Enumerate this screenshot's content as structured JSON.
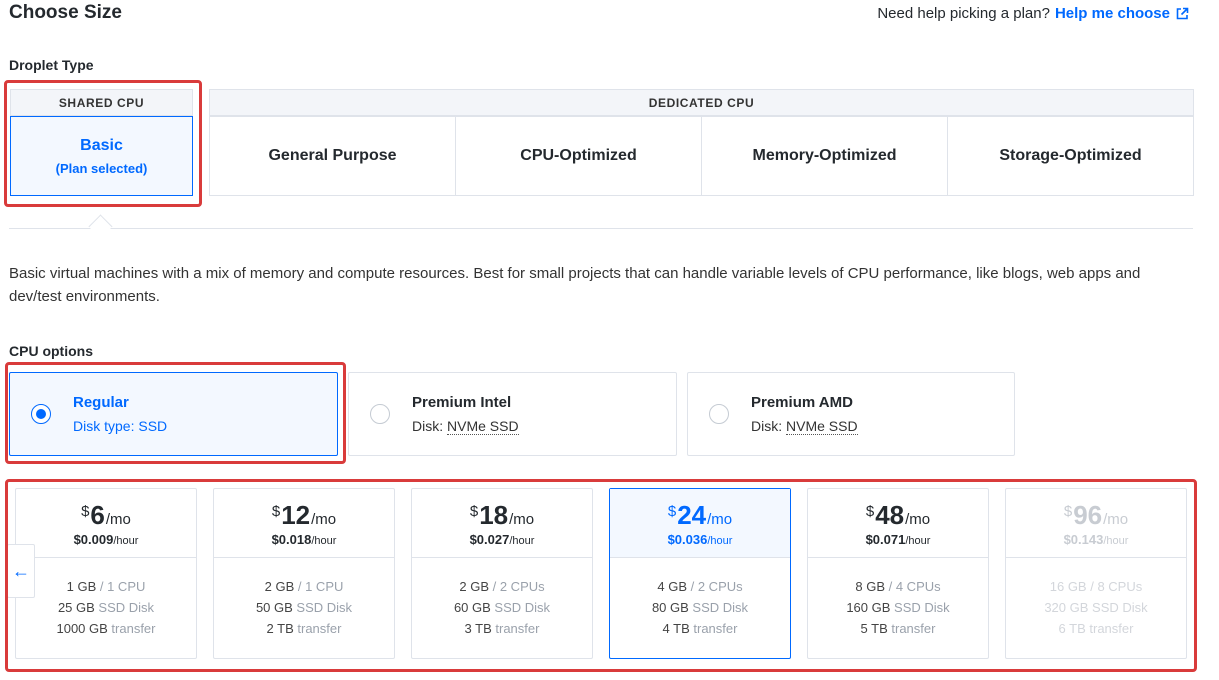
{
  "header": {
    "title": "Choose Size",
    "help_text": "Need help picking a plan?",
    "help_link": "Help me choose"
  },
  "droplet_type": {
    "label": "Droplet Type",
    "shared_header": "SHARED CPU",
    "dedicated_header": "DEDICATED CPU",
    "basic": {
      "label": "Basic",
      "sub": "(Plan selected)"
    },
    "dedicated": [
      "General Purpose",
      "CPU-Optimized",
      "Memory-Optimized",
      "Storage-Optimized"
    ]
  },
  "description": "Basic virtual machines with a mix of memory and compute resources. Best for small projects that can handle variable levels of CPU performance, like blogs, web apps and dev/test environments.",
  "cpu_options": {
    "label": "CPU options",
    "options": [
      {
        "name": "Regular",
        "disk_prefix": "Disk type: ",
        "disk_value": "SSD",
        "selected": true
      },
      {
        "name": "Premium Intel",
        "disk_prefix": "Disk: ",
        "disk_value": "NVMe SSD",
        "selected": false
      },
      {
        "name": "Premium AMD",
        "disk_prefix": "Disk: ",
        "disk_value": "NVMe SSD",
        "selected": false
      }
    ]
  },
  "plans": [
    {
      "currency": "$",
      "amount": "6",
      "per": "/mo",
      "hourly": "$0.009",
      "hourly_unit": "/hour",
      "mem": "1 GB",
      "cpu": " / 1 CPU",
      "disk": "25 GB",
      "disk_type": " SSD Disk",
      "transfer": "1000 GB",
      "transfer_label": " transfer",
      "state": "normal"
    },
    {
      "currency": "$",
      "amount": "12",
      "per": "/mo",
      "hourly": "$0.018",
      "hourly_unit": "/hour",
      "mem": "2 GB",
      "cpu": " / 1 CPU",
      "disk": "50 GB",
      "disk_type": " SSD Disk",
      "transfer": "2 TB",
      "transfer_label": " transfer",
      "state": "normal"
    },
    {
      "currency": "$",
      "amount": "18",
      "per": "/mo",
      "hourly": "$0.027",
      "hourly_unit": "/hour",
      "mem": "2 GB",
      "cpu": " / 2 CPUs",
      "disk": "60 GB",
      "disk_type": " SSD Disk",
      "transfer": "3 TB",
      "transfer_label": " transfer",
      "state": "normal"
    },
    {
      "currency": "$",
      "amount": "24",
      "per": "/mo",
      "hourly": "$0.036",
      "hourly_unit": "/hour",
      "mem": "4 GB",
      "cpu": " / 2 CPUs",
      "disk": "80 GB",
      "disk_type": " SSD Disk",
      "transfer": "4 TB",
      "transfer_label": " transfer",
      "state": "selected"
    },
    {
      "currency": "$",
      "amount": "48",
      "per": "/mo",
      "hourly": "$0.071",
      "hourly_unit": "/hour",
      "mem": "8 GB",
      "cpu": " / 4 CPUs",
      "disk": "160 GB",
      "disk_type": " SSD Disk",
      "transfer": "5 TB",
      "transfer_label": " transfer",
      "state": "normal"
    },
    {
      "currency": "$",
      "amount": "96",
      "per": "/mo",
      "hourly": "$0.143",
      "hourly_unit": "/hour",
      "mem": "16 GB",
      "cpu": " / 8 CPUs",
      "disk": "320 GB",
      "disk_type": " SSD Disk",
      "transfer": "6 TB",
      "transfer_label": " transfer",
      "state": "disabled"
    }
  ],
  "scroll_left_icon": "arrow-left-icon",
  "colors": {
    "accent": "#0069ff",
    "highlight": "#d93b3b",
    "selected_bg": "#f3f8ff"
  }
}
